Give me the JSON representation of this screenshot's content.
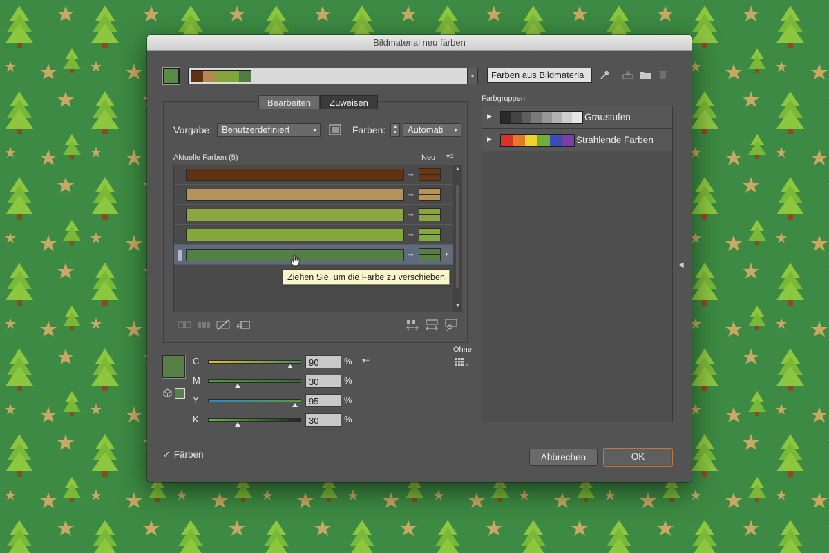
{
  "dialog": {
    "title": "Bildmaterial neu färben"
  },
  "toolbar": {
    "colors_from_artwork_label": "Farben aus Bildmateria",
    "harmony_colors": [
      "#5e3212",
      "#b08a50",
      "#8aa23c",
      "#7ea63a",
      "#557c44"
    ]
  },
  "tabs": [
    {
      "label": "Bearbeiten",
      "active": false
    },
    {
      "label": "Zuweisen",
      "active": true
    }
  ],
  "preset": {
    "label": "Vorgabe:",
    "value": "Benutzerdefiniert"
  },
  "colors_count": {
    "label": "Farben:",
    "value": "Automati"
  },
  "current_colors": {
    "header": "Aktuelle Farben (5)",
    "new_header": "Neu",
    "rows": [
      {
        "current": "#5e3212",
        "new": "#6a3712"
      },
      {
        "current": "#b3925c",
        "new": "#b69457"
      },
      {
        "current": "#8ba640",
        "new": "#8ba640"
      },
      {
        "current": "#85a83c",
        "new": "#84a93c"
      },
      {
        "current": "#567f45",
        "new": "#567f45",
        "selected": true
      }
    ]
  },
  "tooltip": {
    "text": "Ziehen Sie, um die Farbe zu verschieben"
  },
  "cmyk": {
    "swatch_color": "#577f46",
    "channels": [
      {
        "name": "C",
        "value": "90",
        "fraction": 0.9,
        "gradient": [
          "#e6c02a",
          "#4a8a5a"
        ]
      },
      {
        "name": "M",
        "value": "30",
        "fraction": 0.3,
        "gradient": [
          "#4b9a42",
          "#3a6a3a"
        ]
      },
      {
        "name": "Y",
        "value": "95",
        "fraction": 0.95,
        "gradient": [
          "#2a8ac8",
          "#5a9a3a"
        ]
      },
      {
        "name": "K",
        "value": "30",
        "fraction": 0.3,
        "gradient": [
          "#6ab84a",
          "#1e2a1c"
        ]
      }
    ],
    "unit": "%"
  },
  "ohne_label": "Ohne",
  "color_groups": {
    "label": "Farbgruppen",
    "items": [
      {
        "name": "Graustufen",
        "colors": [
          "#2a2a2a",
          "#444444",
          "#5e5e5e",
          "#7a7a7a",
          "#969696",
          "#b2b2b2",
          "#cecece",
          "#e6e6e6"
        ]
      },
      {
        "name": "Strahlende Farben",
        "colors": [
          "#d8332a",
          "#e47a26",
          "#f2d32e",
          "#6fae3c",
          "#3a4cb8",
          "#7a3fa6"
        ]
      }
    ]
  },
  "recolor_checkbox": {
    "label": "Färben",
    "checked": true
  },
  "buttons": {
    "cancel": "Abbrechen",
    "ok": "OK"
  }
}
